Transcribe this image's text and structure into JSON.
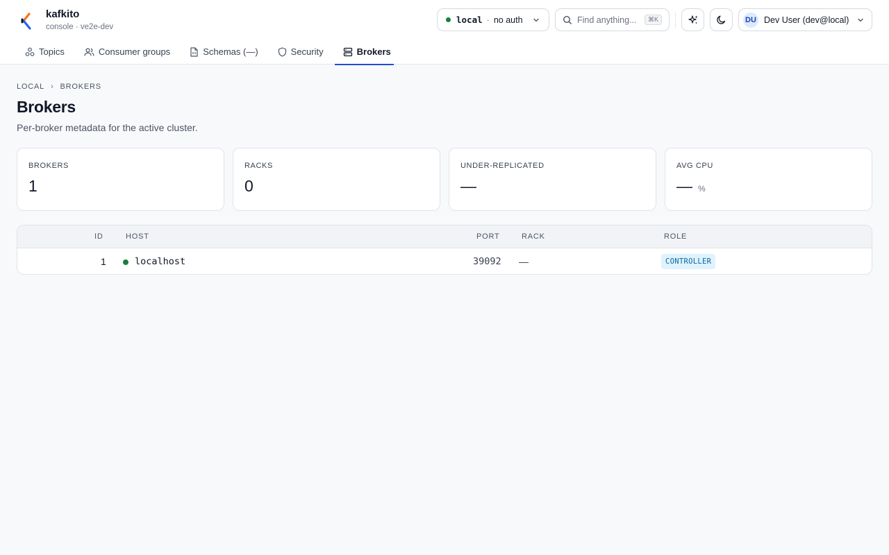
{
  "app": {
    "name": "kafkito",
    "subtitle": "console · ve2e-dev"
  },
  "header": {
    "cluster": {
      "name": "local",
      "separator": "·",
      "auth": "no auth",
      "status_color": "#15803d"
    },
    "search": {
      "placeholder": "Find anything...",
      "shortcut": "⌘K"
    },
    "user": {
      "initials": "DU",
      "label": "Dev User (dev@local)"
    }
  },
  "tabs": [
    {
      "label": "Topics",
      "icon": "topics-icon",
      "active": false
    },
    {
      "label": "Consumer groups",
      "icon": "users-icon",
      "active": false
    },
    {
      "label": "Schemas (—)",
      "icon": "schema-file-icon",
      "active": false
    },
    {
      "label": "Security",
      "icon": "shield-icon",
      "active": false
    },
    {
      "label": "Brokers",
      "icon": "server-icon",
      "active": true
    }
  ],
  "breadcrumb": [
    "LOCAL",
    "BROKERS"
  ],
  "breadcrumb_separator": "›",
  "page": {
    "title": "Brokers",
    "description": "Per-broker metadata for the active cluster."
  },
  "stats": [
    {
      "label": "BROKERS",
      "value": "1",
      "unit": ""
    },
    {
      "label": "RACKS",
      "value": "0",
      "unit": ""
    },
    {
      "label": "UNDER-REPLICATED",
      "value": "—",
      "unit": ""
    },
    {
      "label": "AVG CPU",
      "value": "—",
      "unit": "%"
    }
  ],
  "table": {
    "columns": [
      "ID",
      "HOST",
      "PORT",
      "RACK",
      "ROLE"
    ],
    "rows": [
      {
        "id": "1",
        "host": "localhost",
        "port": "39092",
        "rack": "—",
        "role": "CONTROLLER",
        "status_color": "#15803d"
      }
    ]
  },
  "colors": {
    "accent": "#1d4ed8",
    "status_ok": "#15803d",
    "role_badge_bg": "#e0f2fe",
    "role_badge_text": "#0369a1"
  }
}
